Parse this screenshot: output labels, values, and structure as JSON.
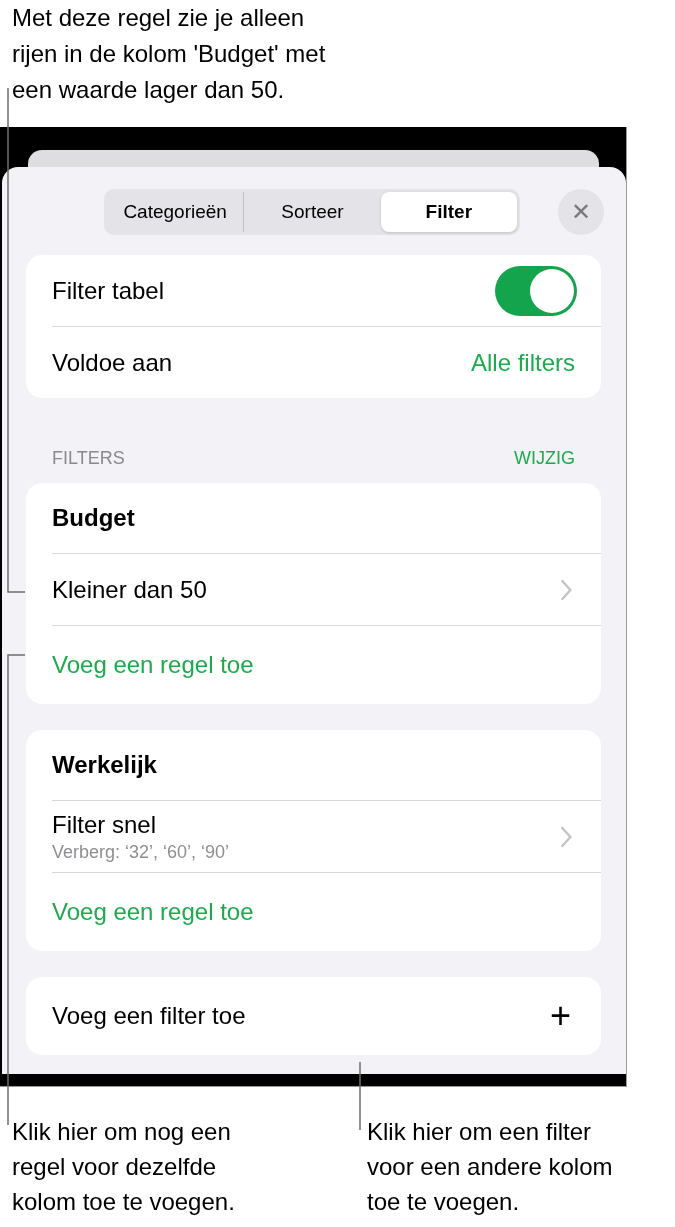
{
  "top_callout": "Met deze regel zie je alleen\nrijen in de kolom 'Budget' met\neen waarde lager dan 50.",
  "segments": [
    {
      "label": "Categorieën",
      "selected": false
    },
    {
      "label": "Sorteer",
      "selected": false
    },
    {
      "label": "Filter",
      "selected": true
    }
  ],
  "close_button": "✕",
  "settings": [
    {
      "kind": "toggle",
      "label": "Filter tabel",
      "on": true
    },
    {
      "kind": "value",
      "label": "Voldoe aan",
      "value": "Alle filters"
    }
  ],
  "filters_header": {
    "title": "FILTERS",
    "action": "WIJZIG"
  },
  "filters": [
    {
      "column": "Budget",
      "rules": [
        {
          "label": "Kleiner dan 50"
        }
      ],
      "add_rule": "Voeg een regel toe"
    },
    {
      "column": "Werkelijk",
      "rules": [
        {
          "label": "Filter snel",
          "detail": "Verberg: ‘32’, ‘60’, ‘90’"
        }
      ],
      "add_rule": "Voeg een regel toe"
    }
  ],
  "add_filter": {
    "label": "Voeg een filter toe",
    "icon": "+"
  },
  "bottom_callouts": [
    "Klik hier om nog een\nregel voor dezelfde\nkolom toe te voegen.",
    "Klik hier om een filter\nvoor een andere kolom\ntoe te voegen."
  ]
}
